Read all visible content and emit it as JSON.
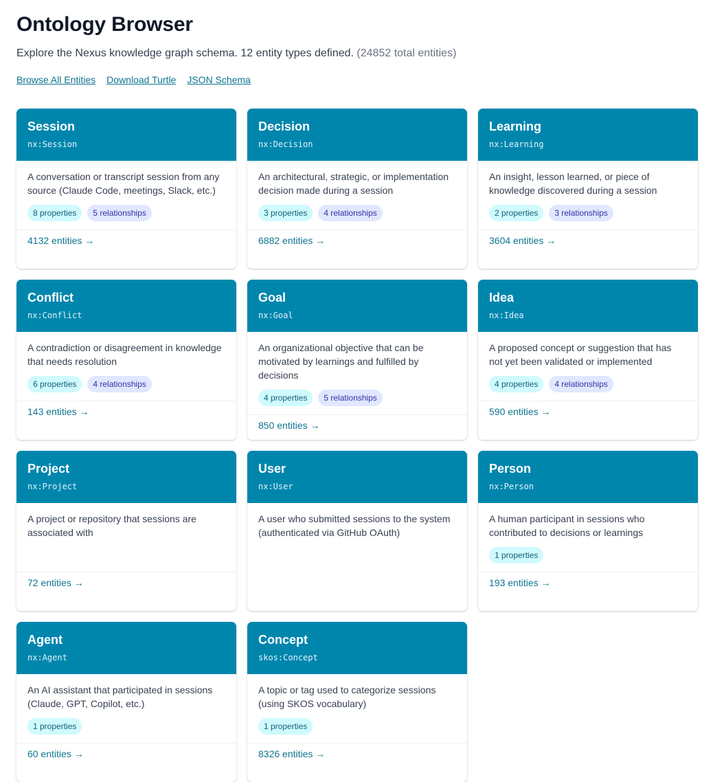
{
  "header": {
    "title": "Ontology Browser",
    "subtitle": "Explore the Nexus knowledge graph schema. 12 entity types defined.",
    "total": "(24852 total entities)"
  },
  "links": [
    {
      "label": "Browse All Entities"
    },
    {
      "label": "Download Turtle"
    },
    {
      "label": "JSON Schema"
    }
  ],
  "colors": {
    "card_header": "#0086ad",
    "link": "#0e7490",
    "props_badge": "#cffafe",
    "rels_badge": "#e0e7ff"
  },
  "cards": [
    {
      "name": "Session",
      "uri": "nx:Session",
      "desc": "A conversation or transcript session from any source (Claude Code, meetings, Slack, etc.)",
      "props": "8 properties",
      "rels": "5 relationships",
      "count": "4132 entities →"
    },
    {
      "name": "Decision",
      "uri": "nx:Decision",
      "desc": "An architectural, strategic, or implementation decision made during a session",
      "props": "3 properties",
      "rels": "4 relationships",
      "count": "6882 entities →"
    },
    {
      "name": "Learning",
      "uri": "nx:Learning",
      "desc": "An insight, lesson learned, or piece of knowledge discovered during a session",
      "props": "2 properties",
      "rels": "3 relationships",
      "count": "3604 entities →"
    },
    {
      "name": "Conflict",
      "uri": "nx:Conflict",
      "desc": "A contradiction or disagreement in knowledge that needs resolution",
      "props": "6 properties",
      "rels": "4 relationships",
      "count": "143 entities →"
    },
    {
      "name": "Goal",
      "uri": "nx:Goal",
      "desc": "An organizational objective that can be motivated by learnings and fulfilled by decisions",
      "props": "4 properties",
      "rels": "5 relationships",
      "count": "850 entities →"
    },
    {
      "name": "Idea",
      "uri": "nx:Idea",
      "desc": "A proposed concept or suggestion that has not yet been validated or implemented",
      "props": "4 properties",
      "rels": "4 relationships",
      "count": "590 entities →"
    },
    {
      "name": "Project",
      "uri": "nx:Project",
      "desc": "A project or repository that sessions are associated with",
      "props": "",
      "rels": "",
      "count": "72 entities →"
    },
    {
      "name": "User",
      "uri": "nx:User",
      "desc": "A user who submitted sessions to the system (authenticated via GitHub OAuth)",
      "props": "",
      "rels": "",
      "count": ""
    },
    {
      "name": "Person",
      "uri": "nx:Person",
      "desc": "A human participant in sessions who contributed to decisions or learnings",
      "props": "1 properties",
      "rels": "",
      "count": "193 entities →"
    },
    {
      "name": "Agent",
      "uri": "nx:Agent",
      "desc": "An AI assistant that participated in sessions (Claude, GPT, Copilot, etc.)",
      "props": "1 properties",
      "rels": "",
      "count": "60 entities →"
    },
    {
      "name": "Concept",
      "uri": "skos:Concept",
      "desc": "A topic or tag used to categorize sessions (using SKOS vocabulary)",
      "props": "1 properties",
      "rels": "",
      "count": "8326 entities →"
    }
  ]
}
